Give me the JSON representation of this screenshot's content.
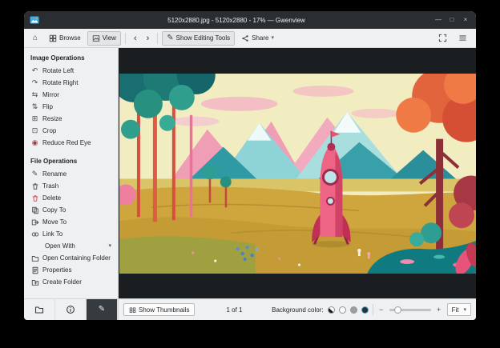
{
  "window": {
    "title": "5120x2880.jpg - 5120x2880 - 17% — Gwenview"
  },
  "icons": {
    "home": "⌂",
    "back": "‹",
    "forward": "›",
    "pencil": "✎",
    "chevron_down": "▾",
    "rotate_left": "↶",
    "rotate_right": "↷",
    "mirror": "⇆",
    "flip": "⇅",
    "resize": "⊞",
    "crop": "⊡",
    "red_eye": "◉",
    "minimize": "—",
    "maximize": "□",
    "close": "×",
    "zoom_out": "−",
    "zoom_in": "+"
  },
  "toolbar": {
    "browse_label": "Browse",
    "view_label": "View",
    "editing_label": "Show Editing Tools",
    "share_label": "Share"
  },
  "sidebar": {
    "image_operations": {
      "header": "Image Operations",
      "items": [
        {
          "label": "Rotate Left"
        },
        {
          "label": "Rotate Right"
        },
        {
          "label": "Mirror"
        },
        {
          "label": "Flip"
        },
        {
          "label": "Resize"
        },
        {
          "label": "Crop"
        },
        {
          "label": "Reduce Red Eye"
        }
      ]
    },
    "file_operations": {
      "header": "File Operations",
      "items_top": [
        {
          "label": "Rename"
        },
        {
          "label": "Trash"
        },
        {
          "label": "Delete"
        },
        {
          "label": "Copy To"
        },
        {
          "label": "Move To"
        },
        {
          "label": "Link To"
        }
      ],
      "open_with_label": "Open With",
      "items_bottom": [
        {
          "label": "Open Containing Folder"
        },
        {
          "label": "Properties"
        },
        {
          "label": "Create Folder"
        }
      ]
    }
  },
  "statusbar": {
    "show_thumbnails_label": "Show Thumbnails",
    "position_label": "1 of 1",
    "background_color_label": "Background color:",
    "zoom_mode_label": "Fit"
  },
  "colors": {
    "titlebar_bg": "#2b2e31",
    "chrome_bg": "#eff0f1",
    "viewer_bg": "#1b1e20",
    "accent": "#3daee9",
    "delete_red": "#da4453"
  }
}
